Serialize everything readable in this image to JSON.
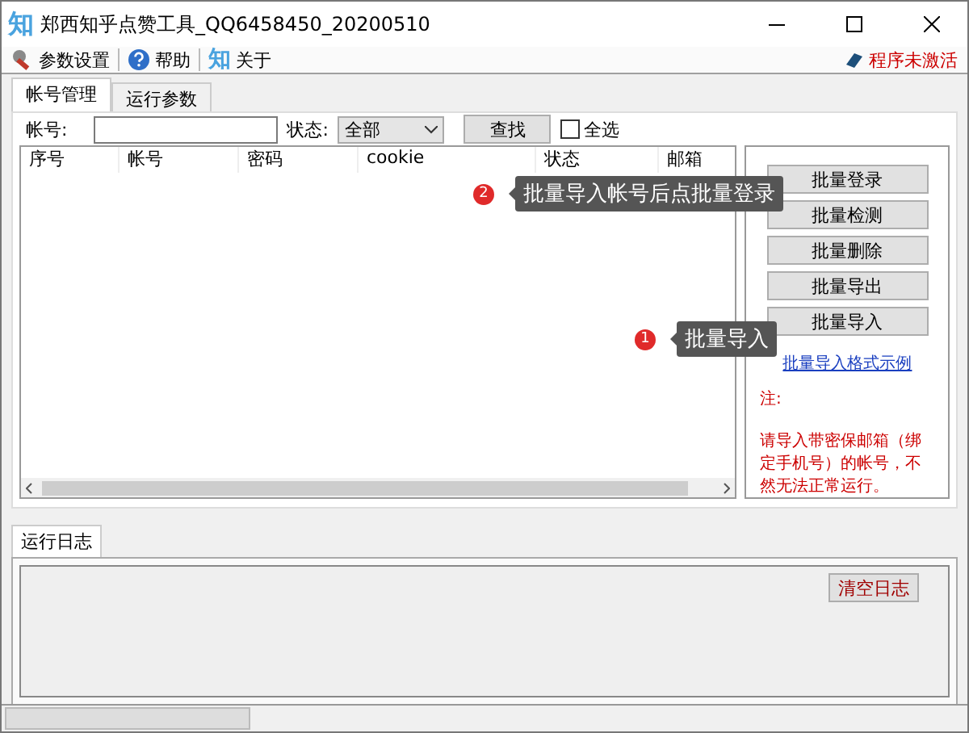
{
  "window": {
    "icon_text": "知",
    "title": "郑西知乎点赞工具_QQ6458450_20200510"
  },
  "toolbar": {
    "items": [
      {
        "kind": "settings",
        "label": "参数设置"
      },
      {
        "kind": "help",
        "label": "帮助"
      },
      {
        "kind": "logo",
        "icon_text": "知",
        "label": "关于"
      }
    ],
    "activation_status": "程序未激活"
  },
  "tabs": [
    {
      "label": "帐号管理",
      "selected": true
    },
    {
      "label": "运行参数",
      "selected": false
    }
  ],
  "filter": {
    "account_label": "帐号:",
    "status_label": "状态:",
    "status_value": "全部",
    "search_button": "查找",
    "select_all": {
      "label": "全选",
      "checked": false
    }
  },
  "table": {
    "columns": [
      "序号",
      "帐号",
      "密码",
      "cookie",
      "状态",
      "邮箱"
    ]
  },
  "side_panel": {
    "buttons": [
      "批量登录",
      "批量检测",
      "批量删除",
      "批量导出",
      "批量导入"
    ],
    "link": "批量导入格式示例",
    "note_title": "注:",
    "note": "请导入带密保邮箱（绑定手机号）的帐号，不然无法正常运行。"
  },
  "callouts": [
    {
      "number": "2",
      "text": "批量导入帐号后点批量登录"
    },
    {
      "number": "1",
      "text": "批量导入"
    }
  ],
  "log": {
    "tab": "运行日志",
    "clear_button": "清空日志"
  }
}
